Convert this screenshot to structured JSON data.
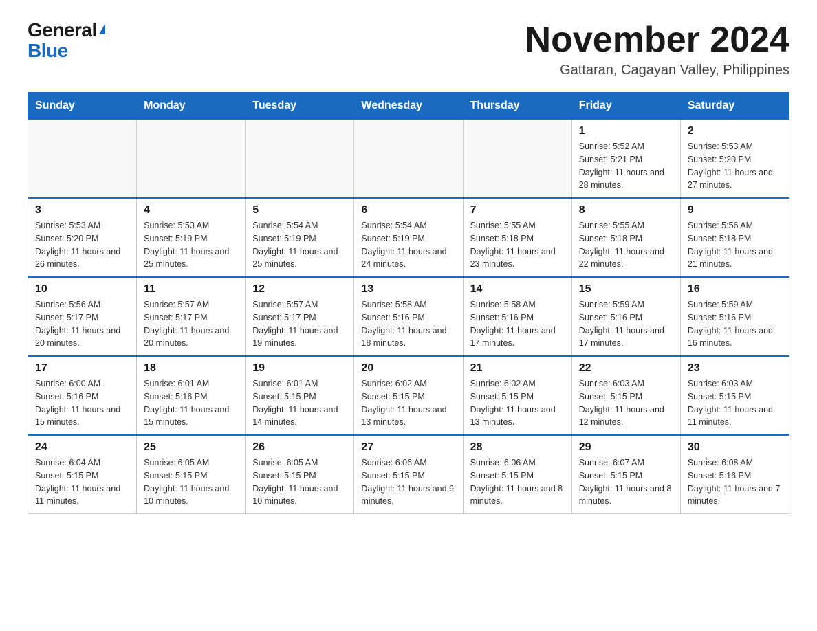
{
  "header": {
    "logo_general": "General",
    "logo_blue": "Blue",
    "month_title": "November 2024",
    "subtitle": "Gattaran, Cagayan Valley, Philippines"
  },
  "days_of_week": [
    "Sunday",
    "Monday",
    "Tuesday",
    "Wednesday",
    "Thursday",
    "Friday",
    "Saturday"
  ],
  "weeks": [
    [
      {
        "day": "",
        "info": ""
      },
      {
        "day": "",
        "info": ""
      },
      {
        "day": "",
        "info": ""
      },
      {
        "day": "",
        "info": ""
      },
      {
        "day": "",
        "info": ""
      },
      {
        "day": "1",
        "info": "Sunrise: 5:52 AM\nSunset: 5:21 PM\nDaylight: 11 hours and 28 minutes."
      },
      {
        "day": "2",
        "info": "Sunrise: 5:53 AM\nSunset: 5:20 PM\nDaylight: 11 hours and 27 minutes."
      }
    ],
    [
      {
        "day": "3",
        "info": "Sunrise: 5:53 AM\nSunset: 5:20 PM\nDaylight: 11 hours and 26 minutes."
      },
      {
        "day": "4",
        "info": "Sunrise: 5:53 AM\nSunset: 5:19 PM\nDaylight: 11 hours and 25 minutes."
      },
      {
        "day": "5",
        "info": "Sunrise: 5:54 AM\nSunset: 5:19 PM\nDaylight: 11 hours and 25 minutes."
      },
      {
        "day": "6",
        "info": "Sunrise: 5:54 AM\nSunset: 5:19 PM\nDaylight: 11 hours and 24 minutes."
      },
      {
        "day": "7",
        "info": "Sunrise: 5:55 AM\nSunset: 5:18 PM\nDaylight: 11 hours and 23 minutes."
      },
      {
        "day": "8",
        "info": "Sunrise: 5:55 AM\nSunset: 5:18 PM\nDaylight: 11 hours and 22 minutes."
      },
      {
        "day": "9",
        "info": "Sunrise: 5:56 AM\nSunset: 5:18 PM\nDaylight: 11 hours and 21 minutes."
      }
    ],
    [
      {
        "day": "10",
        "info": "Sunrise: 5:56 AM\nSunset: 5:17 PM\nDaylight: 11 hours and 20 minutes."
      },
      {
        "day": "11",
        "info": "Sunrise: 5:57 AM\nSunset: 5:17 PM\nDaylight: 11 hours and 20 minutes."
      },
      {
        "day": "12",
        "info": "Sunrise: 5:57 AM\nSunset: 5:17 PM\nDaylight: 11 hours and 19 minutes."
      },
      {
        "day": "13",
        "info": "Sunrise: 5:58 AM\nSunset: 5:16 PM\nDaylight: 11 hours and 18 minutes."
      },
      {
        "day": "14",
        "info": "Sunrise: 5:58 AM\nSunset: 5:16 PM\nDaylight: 11 hours and 17 minutes."
      },
      {
        "day": "15",
        "info": "Sunrise: 5:59 AM\nSunset: 5:16 PM\nDaylight: 11 hours and 17 minutes."
      },
      {
        "day": "16",
        "info": "Sunrise: 5:59 AM\nSunset: 5:16 PM\nDaylight: 11 hours and 16 minutes."
      }
    ],
    [
      {
        "day": "17",
        "info": "Sunrise: 6:00 AM\nSunset: 5:16 PM\nDaylight: 11 hours and 15 minutes."
      },
      {
        "day": "18",
        "info": "Sunrise: 6:01 AM\nSunset: 5:16 PM\nDaylight: 11 hours and 15 minutes."
      },
      {
        "day": "19",
        "info": "Sunrise: 6:01 AM\nSunset: 5:15 PM\nDaylight: 11 hours and 14 minutes."
      },
      {
        "day": "20",
        "info": "Sunrise: 6:02 AM\nSunset: 5:15 PM\nDaylight: 11 hours and 13 minutes."
      },
      {
        "day": "21",
        "info": "Sunrise: 6:02 AM\nSunset: 5:15 PM\nDaylight: 11 hours and 13 minutes."
      },
      {
        "day": "22",
        "info": "Sunrise: 6:03 AM\nSunset: 5:15 PM\nDaylight: 11 hours and 12 minutes."
      },
      {
        "day": "23",
        "info": "Sunrise: 6:03 AM\nSunset: 5:15 PM\nDaylight: 11 hours and 11 minutes."
      }
    ],
    [
      {
        "day": "24",
        "info": "Sunrise: 6:04 AM\nSunset: 5:15 PM\nDaylight: 11 hours and 11 minutes."
      },
      {
        "day": "25",
        "info": "Sunrise: 6:05 AM\nSunset: 5:15 PM\nDaylight: 11 hours and 10 minutes."
      },
      {
        "day": "26",
        "info": "Sunrise: 6:05 AM\nSunset: 5:15 PM\nDaylight: 11 hours and 10 minutes."
      },
      {
        "day": "27",
        "info": "Sunrise: 6:06 AM\nSunset: 5:15 PM\nDaylight: 11 hours and 9 minutes."
      },
      {
        "day": "28",
        "info": "Sunrise: 6:06 AM\nSunset: 5:15 PM\nDaylight: 11 hours and 8 minutes."
      },
      {
        "day": "29",
        "info": "Sunrise: 6:07 AM\nSunset: 5:15 PM\nDaylight: 11 hours and 8 minutes."
      },
      {
        "day": "30",
        "info": "Sunrise: 6:08 AM\nSunset: 5:16 PM\nDaylight: 11 hours and 7 minutes."
      }
    ]
  ]
}
